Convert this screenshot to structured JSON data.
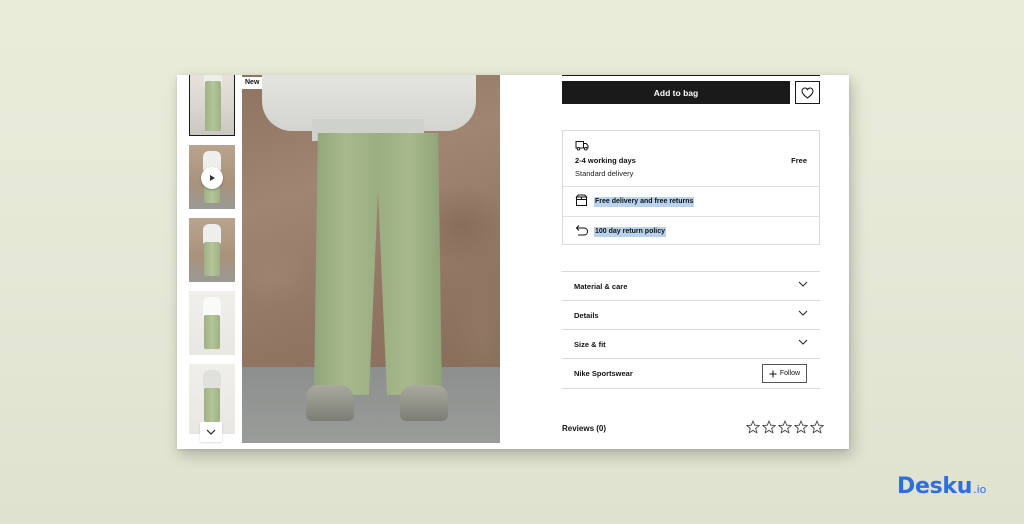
{
  "gallery": {
    "badge": "New",
    "thumbnail_count": 5
  },
  "product": {
    "add_to_bag_label": "Add to bag"
  },
  "delivery": {
    "days": "2-4 working days",
    "price": "Free",
    "type": "Standard delivery",
    "free_returns": "Free delivery and free returns",
    "return_policy": "100 day return policy"
  },
  "accordion": [
    {
      "label": "Material & care"
    },
    {
      "label": "Details"
    },
    {
      "label": "Size & fit"
    }
  ],
  "brand_row": {
    "name": "Nike Sportswear",
    "follow_label": "Follow"
  },
  "reviews": {
    "label": "Reviews (0)",
    "rating": 0,
    "max": 5
  },
  "branding": {
    "name": "Desku",
    "tld": ".io"
  },
  "colors": {
    "accent": "#2d6fe0",
    "button": "#1a1a1a",
    "highlight": "#b9d3ef"
  }
}
